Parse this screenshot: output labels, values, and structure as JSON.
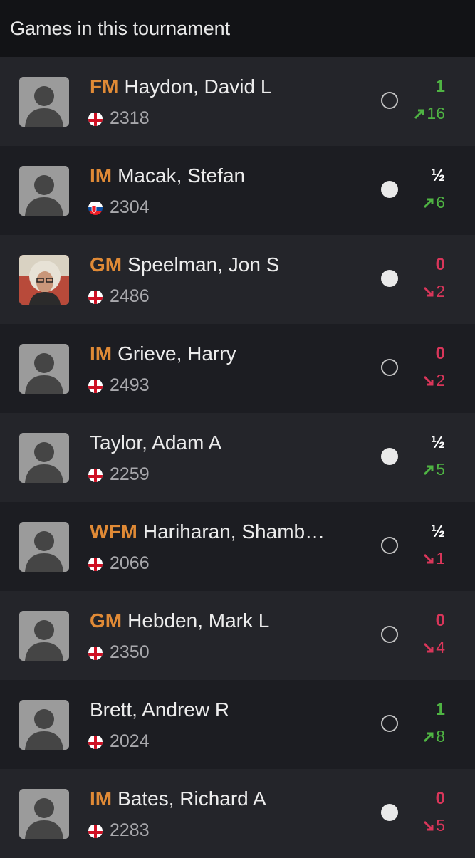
{
  "header": {
    "title": "Games in this tournament"
  },
  "colors": {
    "title": "#e08a36",
    "up": "#4fb443",
    "down": "#d9365a"
  },
  "games": [
    {
      "title": "FM",
      "name": "Haydon, David L",
      "flag": "england",
      "rating": "2318",
      "piece": "black",
      "result": "1",
      "result_color": "up",
      "change": "16",
      "direction": "up",
      "avatar": "placeholder"
    },
    {
      "title": "IM",
      "name": "Macak, Stefan",
      "flag": "slovakia",
      "rating": "2304",
      "piece": "white",
      "result": "½",
      "result_color": "neutral",
      "change": "6",
      "direction": "up",
      "avatar": "placeholder"
    },
    {
      "title": "GM",
      "name": "Speelman, Jon S",
      "flag": "england",
      "rating": "2486",
      "piece": "white",
      "result": "0",
      "result_color": "down",
      "change": "2",
      "direction": "down",
      "avatar": "photo"
    },
    {
      "title": "IM",
      "name": "Grieve, Harry",
      "flag": "england",
      "rating": "2493",
      "piece": "black",
      "result": "0",
      "result_color": "down",
      "change": "2",
      "direction": "down",
      "avatar": "placeholder"
    },
    {
      "title": "",
      "name": "Taylor, Adam A",
      "flag": "england",
      "rating": "2259",
      "piece": "white",
      "result": "½",
      "result_color": "neutral",
      "change": "5",
      "direction": "up",
      "avatar": "placeholder"
    },
    {
      "title": "WFM",
      "name": "Hariharan, Shamb…",
      "flag": "england",
      "rating": "2066",
      "piece": "black",
      "result": "½",
      "result_color": "neutral",
      "change": "1",
      "direction": "down",
      "avatar": "placeholder"
    },
    {
      "title": "GM",
      "name": "Hebden, Mark L",
      "flag": "england",
      "rating": "2350",
      "piece": "black",
      "result": "0",
      "result_color": "down",
      "change": "4",
      "direction": "down",
      "avatar": "placeholder"
    },
    {
      "title": "",
      "name": "Brett, Andrew R",
      "flag": "england",
      "rating": "2024",
      "piece": "black",
      "result": "1",
      "result_color": "up",
      "change": "8",
      "direction": "up",
      "avatar": "placeholder"
    },
    {
      "title": "IM",
      "name": "Bates, Richard A",
      "flag": "england",
      "rating": "2283",
      "piece": "white",
      "result": "0",
      "result_color": "down",
      "change": "5",
      "direction": "down",
      "avatar": "placeholder"
    }
  ]
}
